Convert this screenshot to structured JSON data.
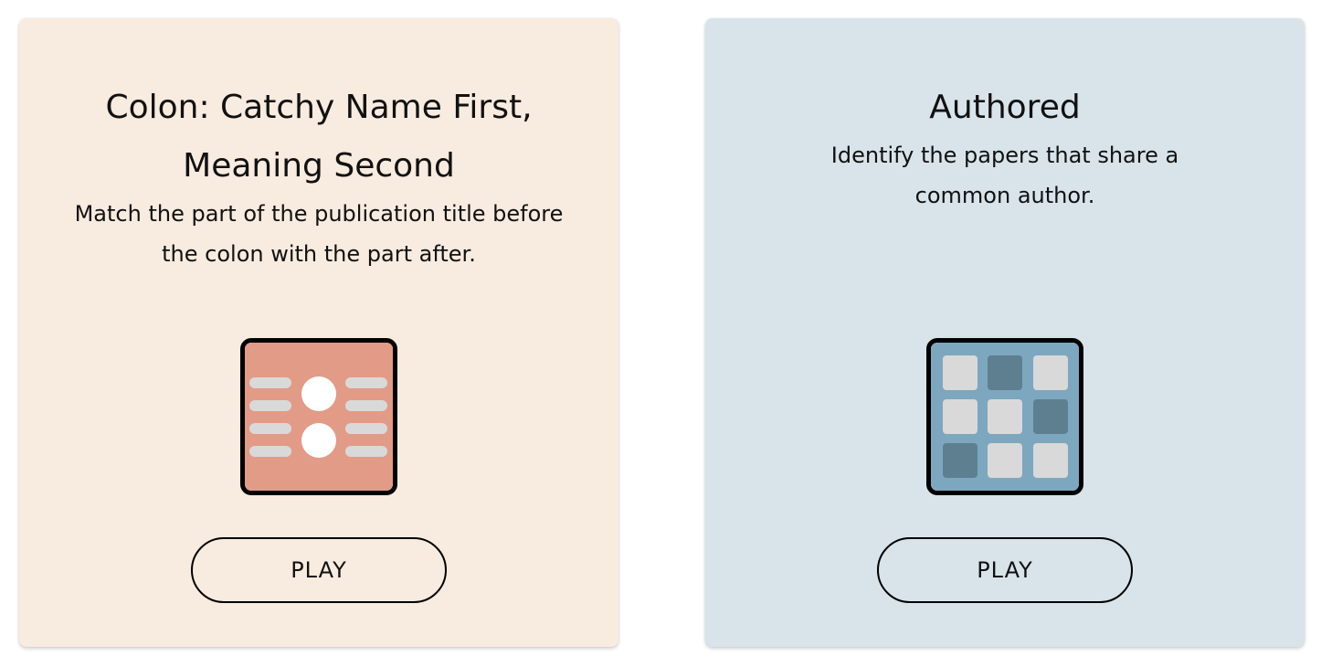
{
  "cards": [
    {
      "title": "Colon: Catchy Name First, Meaning Second",
      "description": "Match the part of the publication title before the colon with the part after.",
      "icon": "colon-match-icon",
      "icon_color": "#e29b87",
      "button_label": "PLAY",
      "background": "#f8ebdf"
    },
    {
      "title": "Authored",
      "description": "Identify the papers that share a common author.",
      "icon": "tile-grid-icon",
      "icon_color": "#7da7be",
      "button_label": "PLAY",
      "background": "#d8e4ea"
    }
  ]
}
